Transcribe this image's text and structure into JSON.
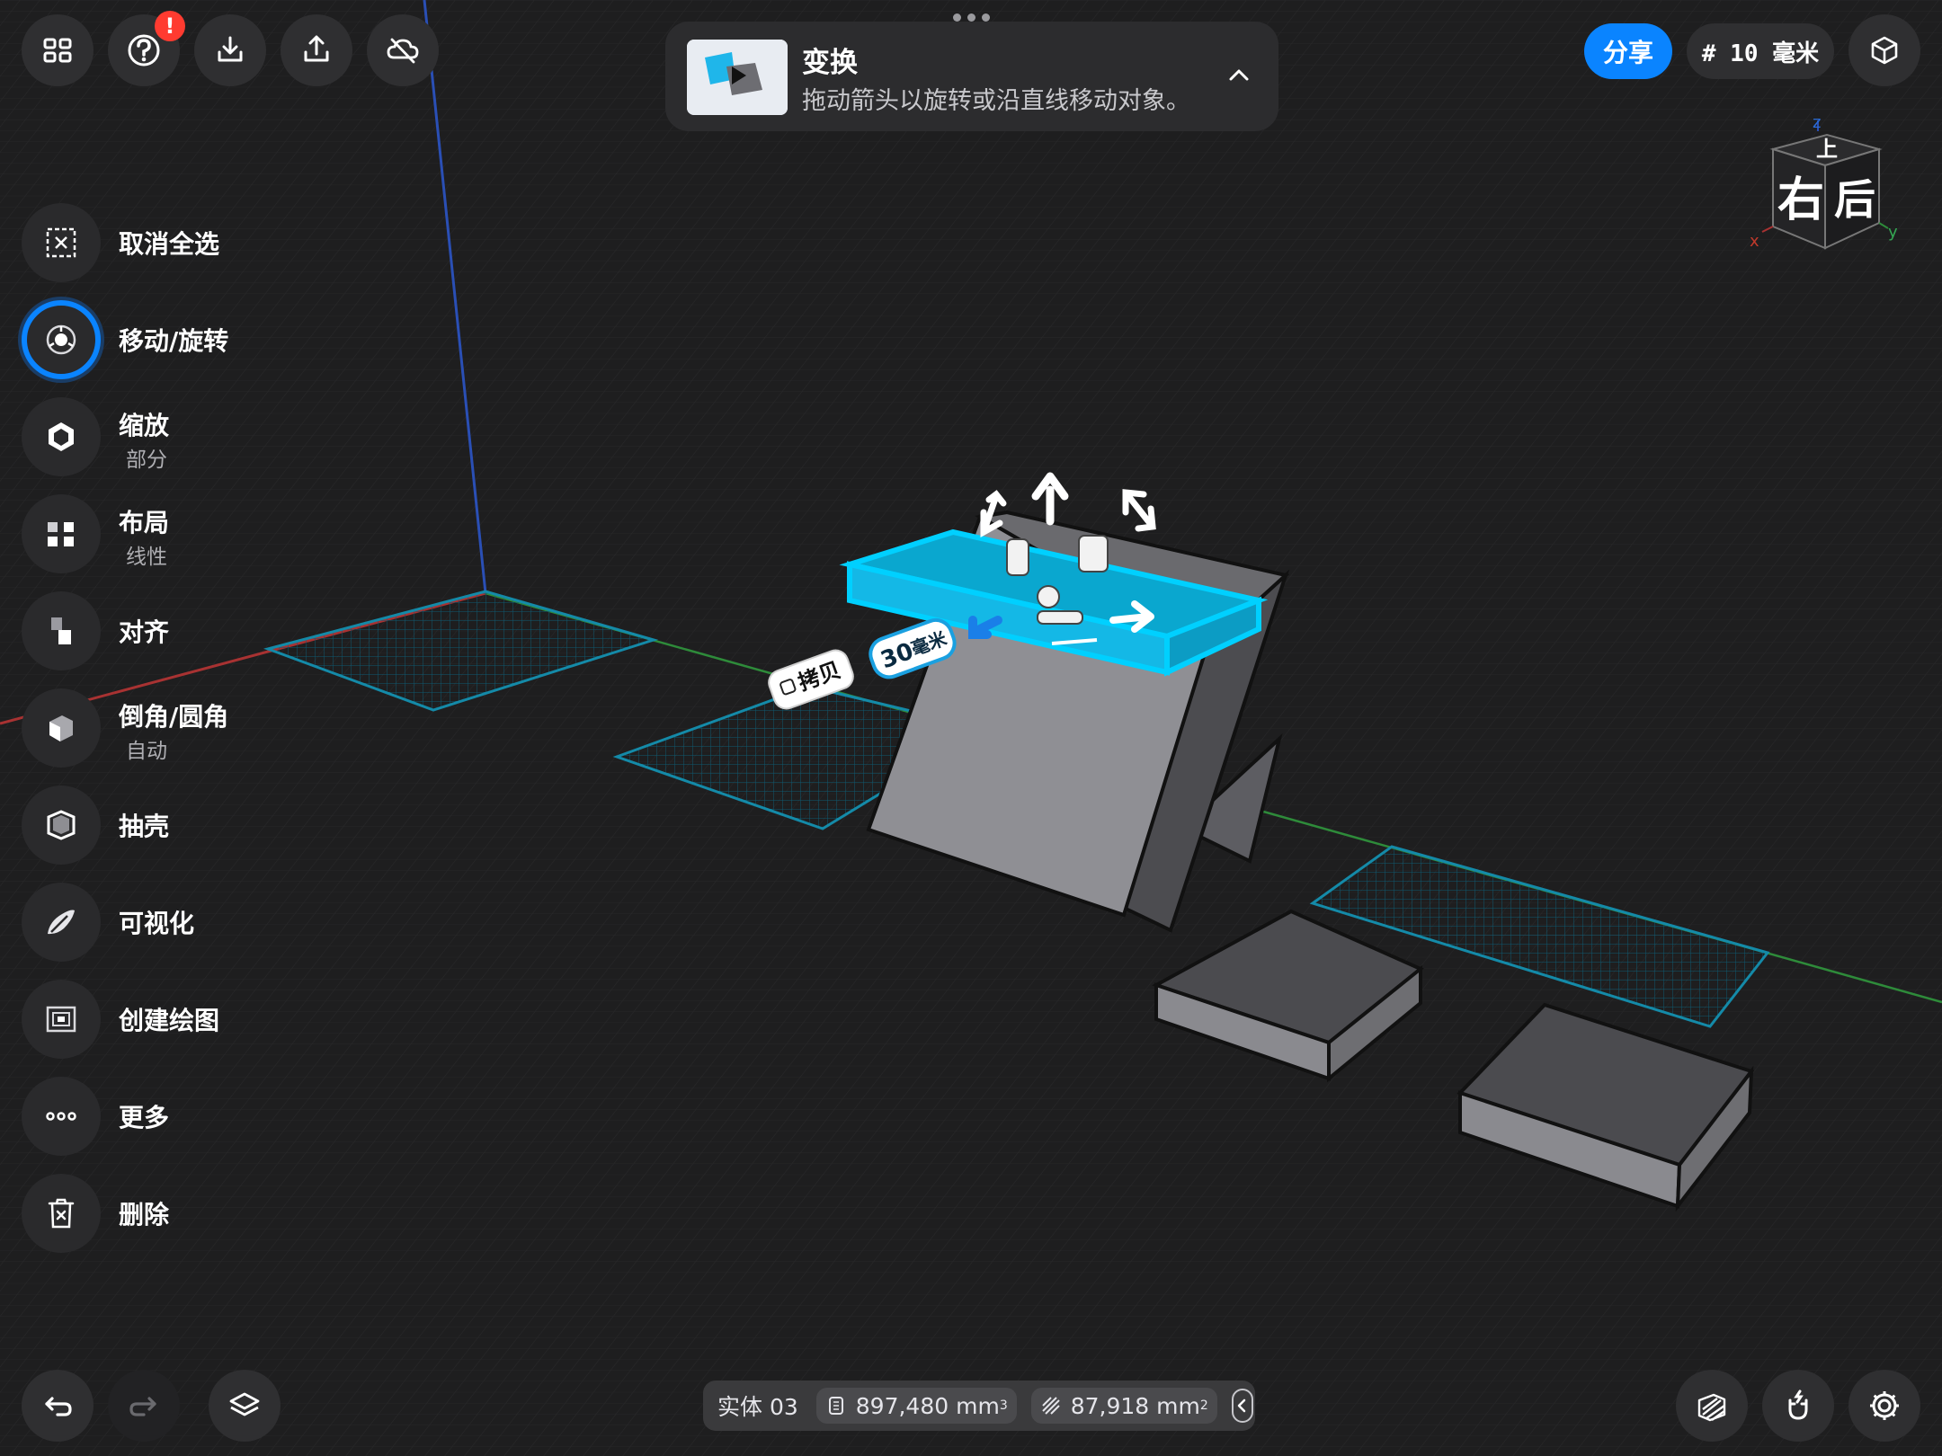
{
  "app": {
    "title": "Shapr3D"
  },
  "top_left": {
    "buttons": [
      {
        "name": "grid-icon"
      },
      {
        "name": "help-icon",
        "badge": "!"
      },
      {
        "name": "import-icon"
      },
      {
        "name": "export-icon"
      },
      {
        "name": "cloud-off-icon"
      }
    ]
  },
  "hint": {
    "title": "变换",
    "text": "拖动箭头以旋转或沿直线移动对象。"
  },
  "top_right": {
    "share_label": "分享",
    "grid_label": "# 10 毫米"
  },
  "view_cube": {
    "face_front": "右",
    "face_side": "后",
    "face_top": "上",
    "axis_z": "z",
    "axis_x": "x",
    "axis_y": "y"
  },
  "toolbar": {
    "items": [
      {
        "label": "取消全选",
        "icon": "deselect-icon"
      },
      {
        "label": "移动/旋转",
        "icon": "move-rotate-icon",
        "active": true
      },
      {
        "label": "缩放",
        "sub": "部分",
        "icon": "scale-icon"
      },
      {
        "label": "布局",
        "sub": "线性",
        "icon": "pattern-icon"
      },
      {
        "label": "对齐",
        "icon": "align-icon"
      },
      {
        "label": "倒角/圆角",
        "sub": "自动",
        "icon": "chamfer-fillet-icon"
      },
      {
        "label": "抽壳",
        "icon": "shell-icon"
      },
      {
        "label": "可视化",
        "icon": "visualize-icon"
      },
      {
        "label": "创建绘图",
        "icon": "drawing-icon"
      },
      {
        "label": "更多",
        "icon": "more-icon"
      },
      {
        "label": "删除",
        "icon": "delete-icon"
      }
    ]
  },
  "scene": {
    "copy_label": "拷贝",
    "distance_value": "30",
    "distance_unit": "毫米"
  },
  "status": {
    "body": "实体 03",
    "volume_value": "897,480 mm",
    "volume_exp": "3",
    "area_value": "87,918 mm",
    "area_exp": "2"
  },
  "colors": {
    "accent": "#0a84ff",
    "selection": "#00c8ff",
    "background": "#1e1e1f",
    "badge": "#ff3b30"
  }
}
